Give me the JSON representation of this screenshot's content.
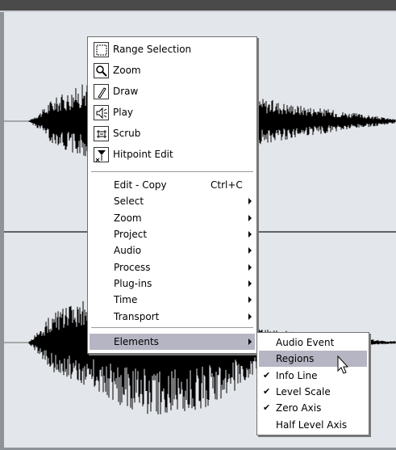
{
  "tool_items": [
    {
      "label": "Range Selection",
      "icon": "range-selection-icon"
    },
    {
      "label": "Zoom",
      "icon": "zoom-icon"
    },
    {
      "label": "Draw",
      "icon": "draw-icon"
    },
    {
      "label": "Play",
      "icon": "play-speaker-icon"
    },
    {
      "label": "Scrub",
      "icon": "scrub-icon"
    },
    {
      "label": "Hitpoint Edit",
      "icon": "hitpoint-edit-icon"
    }
  ],
  "menu_items": [
    {
      "label": "Edit - Copy",
      "shortcut": "Ctrl+C"
    },
    {
      "label": "Select"
    },
    {
      "label": "Zoom"
    },
    {
      "label": "Project"
    },
    {
      "label": "Audio"
    },
    {
      "label": "Process"
    },
    {
      "label": "Plug-ins"
    },
    {
      "label": "Time"
    },
    {
      "label": "Transport"
    },
    {
      "label": "Elements"
    }
  ],
  "submenu_items": [
    {
      "label": "Audio Event",
      "checked": false
    },
    {
      "label": "Regions",
      "checked": false
    },
    {
      "label": "Info Line",
      "checked": true
    },
    {
      "label": "Level Scale",
      "checked": true
    },
    {
      "label": "Zero Axis",
      "checked": true
    },
    {
      "label": "Half Level Axis",
      "checked": false
    }
  ],
  "check_glyph": "✔",
  "highlight_color": "#b6b5c3"
}
